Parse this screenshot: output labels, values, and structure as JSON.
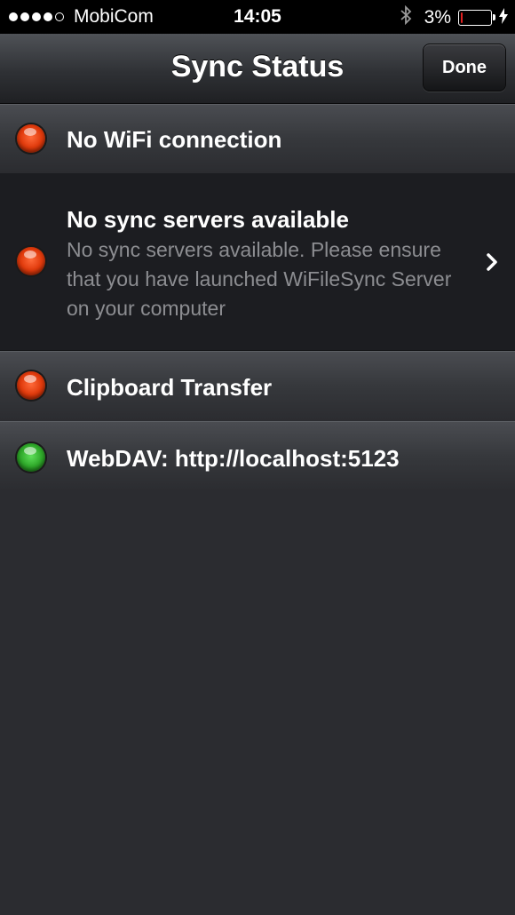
{
  "status_bar": {
    "carrier": "MobiCom",
    "time": "14:05",
    "battery_percent": "3%",
    "battery_level": 0.03,
    "signal_bars_filled": 4,
    "signal_bars_total": 5,
    "icons": [
      "bluetooth-icon",
      "battery-icon",
      "charging-bolt-icon"
    ]
  },
  "navbar": {
    "title": "Sync Status",
    "done_label": "Done"
  },
  "rows": [
    {
      "status": "red",
      "title": "No WiFi connection"
    },
    {
      "status": "red",
      "title": "No sync servers available",
      "subtitle": "No sync servers available. Please ensure that you have launched WiFileSync Server on your computer"
    },
    {
      "status": "red",
      "title": "Clipboard Transfer"
    },
    {
      "status": "green",
      "title": "WebDAV: http://localhost:5123"
    }
  ],
  "colors": {
    "red_led": "#e03a0c",
    "green_led": "#2fa92a",
    "background": "#2b2c30"
  }
}
